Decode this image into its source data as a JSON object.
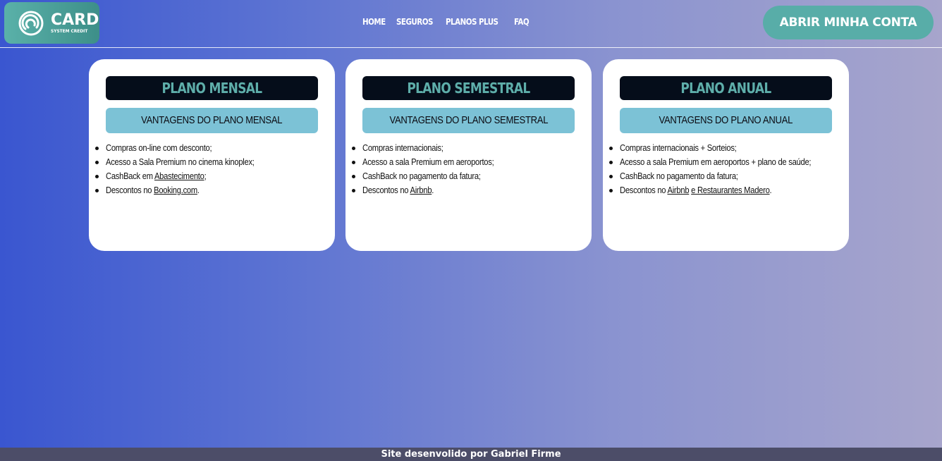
{
  "header": {
    "logo": {
      "title": "CARD",
      "subtitle": "SYSTEM CREDIT"
    },
    "nav": [
      "HOME",
      "SEGUROS",
      "PLANOS PLUS",
      "FAQ"
    ],
    "cta_label": "ABRIR MINHA CONTA"
  },
  "plans": [
    {
      "title": "PLANO MENSAL",
      "subtitle": "VANTAGENS DO PLANO MENSAL",
      "benefits": [
        {
          "pre": "Compras on-line com desconto;"
        },
        {
          "pre": "Acesso a Sala Premium no cinema kinoplex;"
        },
        {
          "pre": "CashBack em ",
          "link": "Abastecimento",
          "post": ";"
        },
        {
          "pre": "Descontos no ",
          "link": "Booking.com",
          "post": "."
        }
      ]
    },
    {
      "title": "PLANO SEMESTRAL",
      "subtitle": "VANTAGENS DO PLANO SEMESTRAL",
      "benefits": [
        {
          "pre": "Compras internacionais;"
        },
        {
          "pre": "Acesso a sala Premium em aeroportos;"
        },
        {
          "pre": "CashBack no pagamento da fatura;"
        },
        {
          "pre": "Descontos no ",
          "link": "Airbnb",
          "post": "."
        }
      ]
    },
    {
      "title": "PLANO ANUAL",
      "subtitle": "VANTAGENS DO PLANO ANUAL",
      "benefits": [
        {
          "pre": "Compras internacionais + Sorteios;"
        },
        {
          "pre": "Acesso a sala Premium em aeroportos + plano de saúde;"
        },
        {
          "pre": "CashBack no pagamento da fatura;"
        },
        {
          "pre": "Descontos no ",
          "link": "Airbnb",
          "mid": " ",
          "link2": "e Restaurantes Madero",
          "post": "."
        }
      ]
    }
  ],
  "footer": {
    "text": "Site desenvolido por Gabriel Firme"
  },
  "colors": {
    "accent": "#58ada8",
    "title_bg": "#050d1a",
    "title_text": "#5eaeaa",
    "subtitle_bg": "#7cc2d6",
    "footer_bg": "#4c4d68"
  }
}
